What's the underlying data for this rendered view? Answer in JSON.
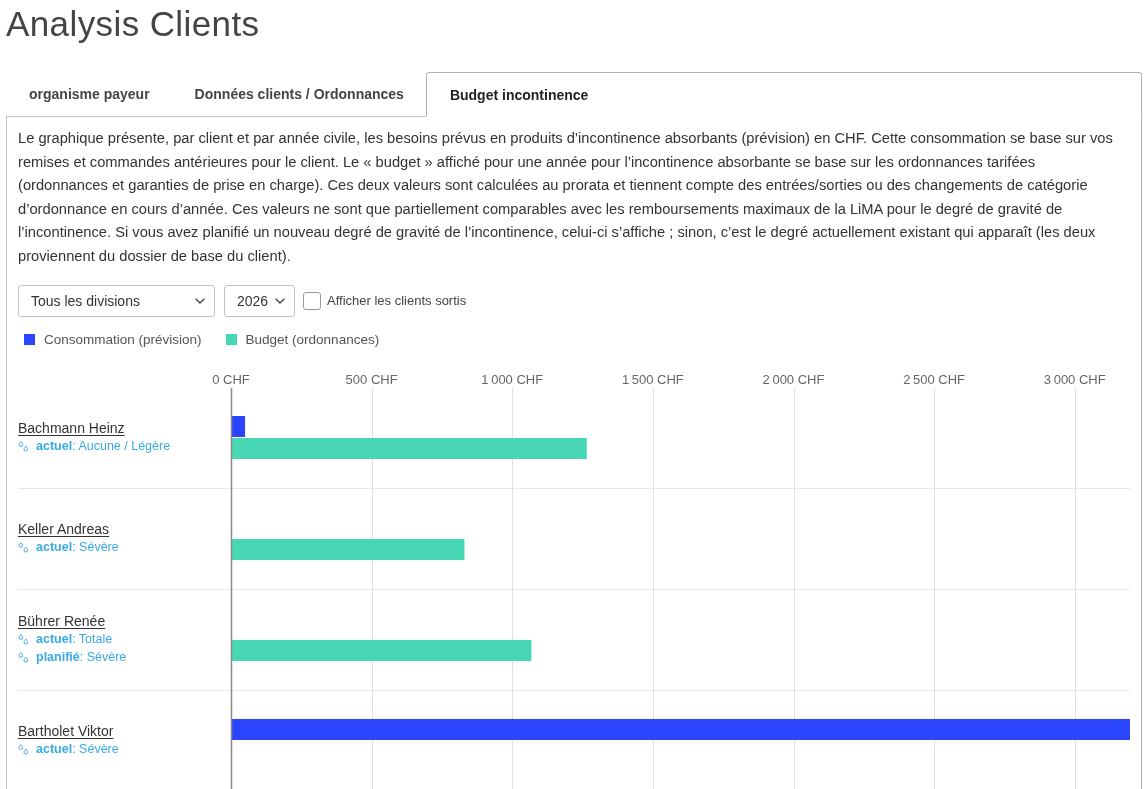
{
  "page": {
    "title": "Analysis Clients"
  },
  "tabs": [
    {
      "label": "organisme payeur",
      "selected": false
    },
    {
      "label": "Données clients / Ordonnances",
      "selected": false
    },
    {
      "label": "Budget incontinence",
      "selected": true
    }
  ],
  "description": "Le graphique présente, par client et par année civile, les besoins prévus en produits d’incontinence absorbants (prévision) en CHF. Cette consommation se base sur vos remises et commandes antérieures pour le client. Le « budget » affiché pour une année pour l’incontinence absorbante se base sur les ordonnances tarifées (ordonnances et garanties de prise en charge). Ces deux valeurs sont calculées au prorata et tiennent compte des entrées/sorties ou des changements de catégorie d’ordonnance en cours d’année. Ces valeurs ne sont que partiellement comparables avec les remboursements maximaux de la LiMA pour le degré de gravité de l’incontinence. Si vous avez planifié un nouveau degré de gravité de l’incontinence, celui-ci s’affiche ; sinon, c’est le degré actuellement existant qui apparaît (les deux proviennent du dossier de base du client).",
  "filters": {
    "division": {
      "value": "Tous les divisions"
    },
    "year": {
      "value": "2026"
    },
    "show_exited": {
      "label": "Afficher les clients sortis",
      "checked": false
    }
  },
  "chart": {
    "chart_data": {
      "type": "bar",
      "orientation": "horizontal",
      "grid": true,
      "categories": [
        "Bachmann Heinz",
        "Keller Andreas",
        "Bührer Renée",
        "Bartholet Viktor"
      ],
      "series": [
        {
          "name": "Consommation (prévision)",
          "color": "#2a45fb",
          "values": [
            50,
            0,
            0,
            3200
          ]
        },
        {
          "name": "Budget (ordonnances)",
          "color": "#48d7b4",
          "values": [
            1265,
            830,
            1068,
            0
          ]
        }
      ],
      "xlim": [
        0,
        3200
      ],
      "xticks": [
        {
          "value": 0,
          "label": "0 CHF"
        },
        {
          "value": 500,
          "label": "500 CHF"
        },
        {
          "value": 1000,
          "label": "1 000 CHF"
        },
        {
          "value": 1500,
          "label": "1 500 CHF"
        },
        {
          "value": 2000,
          "label": "2 000 CHF"
        },
        {
          "value": 2500,
          "label": "2 500 CHF"
        },
        {
          "value": 3000,
          "label": "3 000 CHF"
        }
      ]
    },
    "client_details": [
      {
        "severity": [
          "**actuel**: Aucune / Légère"
        ]
      },
      {
        "severity": [
          "**actuel**: Sévère"
        ]
      },
      {
        "severity": [
          "**actuel**: Totale",
          "**planifié**: Sévère"
        ]
      },
      {
        "severity": [
          "**actuel**: Sévère"
        ]
      }
    ]
  }
}
